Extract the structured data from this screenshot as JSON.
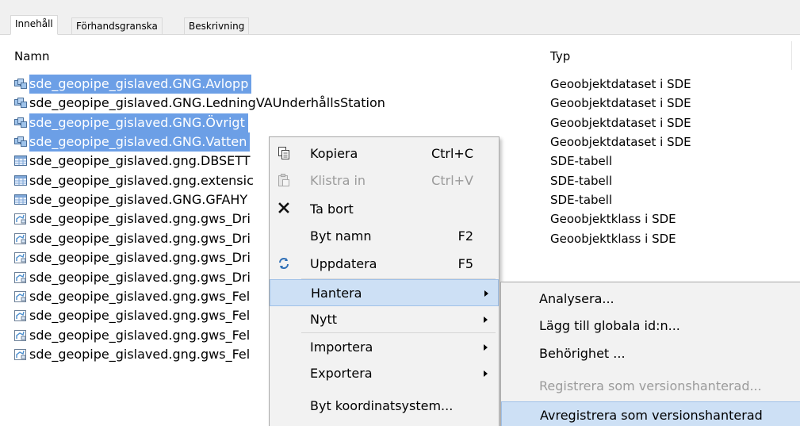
{
  "tabs": [
    "Innehåll",
    "Förhandsgranska",
    "Beskrivning"
  ],
  "columns": {
    "name": "Namn",
    "type": "Typ"
  },
  "rows": [
    {
      "name": "sde_geopipe_gislaved.GNG.Avlopp",
      "type": "Geoobjektdataset i SDE",
      "icon": "feature-dataset-icon",
      "selected": true
    },
    {
      "name": "sde_geopipe_gislaved.GNG.LedningVAUnderhållsStation",
      "type": "Geoobjektdataset i SDE",
      "icon": "feature-dataset-icon",
      "selected": false
    },
    {
      "name": "sde_geopipe_gislaved.GNG.Övrigt",
      "type": "Geoobjektdataset i SDE",
      "icon": "feature-dataset-icon",
      "selected": true
    },
    {
      "name": "sde_geopipe_gislaved.GNG.Vatten",
      "type": "Geoobjektdataset i SDE",
      "icon": "feature-dataset-icon",
      "selected": true
    },
    {
      "name": "sde_geopipe_gislaved.gng.DBSETT",
      "type": "SDE-tabell",
      "icon": "table-icon",
      "selected": false
    },
    {
      "name": "sde_geopipe_gislaved.gng.extensic",
      "type": "SDE-tabell",
      "icon": "table-icon",
      "selected": false
    },
    {
      "name": "sde_geopipe_gislaved.GNG.GFAHY",
      "type": "SDE-tabell",
      "icon": "table-icon",
      "selected": false
    },
    {
      "name": "sde_geopipe_gislaved.gng.gws_Dri",
      "type": "Geoobjektklass i SDE",
      "icon": "feature-class-icon",
      "selected": false
    },
    {
      "name": "sde_geopipe_gislaved.gng.gws_Dri",
      "type": "Geoobjektklass i SDE",
      "icon": "feature-class-icon",
      "selected": false
    },
    {
      "name": "sde_geopipe_gislaved.gng.gws_Dri",
      "type": "",
      "icon": "feature-class-icon",
      "selected": false
    },
    {
      "name": "sde_geopipe_gislaved.gng.gws_Dri",
      "type": "",
      "icon": "feature-class-icon",
      "selected": false
    },
    {
      "name": "sde_geopipe_gislaved.gng.gws_Fel",
      "type": "",
      "icon": "feature-class-icon",
      "selected": false
    },
    {
      "name": "sde_geopipe_gislaved.gng.gws_Fel",
      "type": "",
      "icon": "feature-class-icon",
      "selected": false
    },
    {
      "name": "sde_geopipe_gislaved.gng.gws_Fel",
      "type": "",
      "icon": "feature-class-icon",
      "selected": false
    },
    {
      "name": "sde_geopipe_gislaved.gng.gws_Fel",
      "type": "",
      "icon": "feature-class-icon",
      "selected": false
    }
  ],
  "context_menu": [
    {
      "label": "Kopiera",
      "shortcut": "Ctrl+C",
      "icon": "copy-icon",
      "disabled": false,
      "submenu": false,
      "highlighted": false
    },
    {
      "label": "Klistra in",
      "shortcut": "Ctrl+V",
      "icon": "paste-icon",
      "disabled": true,
      "submenu": false,
      "highlighted": false
    },
    {
      "label": "Ta bort",
      "shortcut": "",
      "icon": "delete-icon",
      "disabled": false,
      "submenu": false,
      "highlighted": false
    },
    {
      "label": "Byt namn",
      "shortcut": "F2",
      "icon": "",
      "disabled": false,
      "submenu": false,
      "highlighted": false
    },
    {
      "label": "Uppdatera",
      "shortcut": "F5",
      "icon": "refresh-icon",
      "disabled": false,
      "submenu": false,
      "highlighted": false
    },
    {
      "label": "Hantera",
      "shortcut": "",
      "icon": "",
      "disabled": false,
      "submenu": true,
      "highlighted": true
    },
    {
      "label": "Nytt",
      "shortcut": "",
      "icon": "",
      "disabled": false,
      "submenu": true,
      "highlighted": false
    },
    {
      "label": "Importera",
      "shortcut": "",
      "icon": "",
      "disabled": false,
      "submenu": true,
      "highlighted": false
    },
    {
      "label": "Exportera",
      "shortcut": "",
      "icon": "",
      "disabled": false,
      "submenu": true,
      "highlighted": false
    },
    {
      "label": "Byt koordinatsystem...",
      "shortcut": "",
      "icon": "",
      "disabled": false,
      "submenu": false,
      "highlighted": false
    }
  ],
  "submenu": [
    {
      "label": "Analysera...",
      "disabled": false,
      "highlighted": false
    },
    {
      "label": "Lägg till globala id:n...",
      "disabled": false,
      "highlighted": false
    },
    {
      "label": "Behörighet ...",
      "disabled": false,
      "highlighted": false
    },
    {
      "label": "Registrera som versionshanterad...",
      "disabled": true,
      "highlighted": false
    },
    {
      "label": "Avregistrera som versionshanterad",
      "disabled": false,
      "highlighted": true
    }
  ],
  "colors": {
    "selection": "#6c9fe6",
    "menu_highlight": "#cde0f5",
    "menu_bg": "#f2f2f2",
    "disabled_text": "#9b9b9b"
  }
}
